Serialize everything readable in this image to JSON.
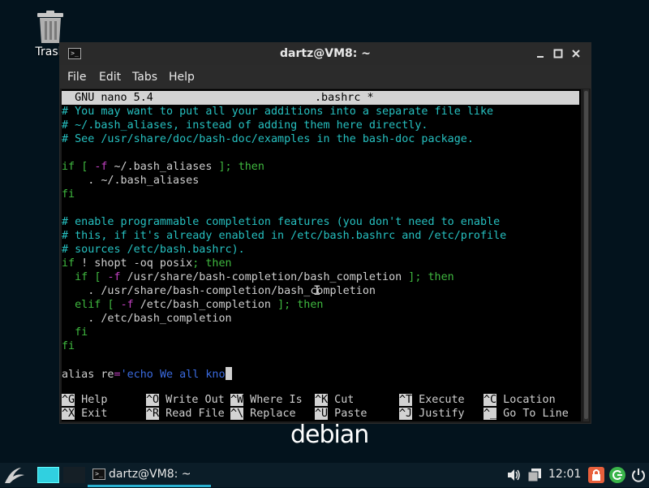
{
  "desktop": {
    "trash_label": "Trash",
    "logo_text": "debian"
  },
  "window": {
    "title": "dartz@VM8: ~",
    "menu": [
      "File",
      "Edit",
      "Tabs",
      "Help"
    ]
  },
  "nano": {
    "header_left": "  GNU nano 5.4",
    "header_file": ".bashrc *",
    "lines": [
      "# You may want to put all your additions into a separate file like",
      "# ~/.bash_aliases, instead of adding them here directly.",
      "# See /usr/share/doc/bash-doc/examples in the bash-doc package.",
      "",
      "if [ -f ~/.bash_aliases ]; then",
      "    . ~/.bash_aliases",
      "fi",
      "",
      "# enable programmable completion features (you don't need to enable",
      "# this, if it's already enabled in /etc/bash.bashrc and /etc/profile",
      "# sources /etc/bash.bashrc).",
      "if ! shopt -oq posix; then",
      "  if [ -f /usr/share/bash-completion/bash_completion ]; then",
      "    . /usr/share/bash-completion/bash_completion",
      "  elif [ -f /etc/bash_completion ]; then",
      "    . /etc/bash_completion",
      "  fi",
      "fi",
      "",
      "alias re='echo We all kno"
    ],
    "shortcuts_row1": [
      {
        "key": "^G",
        "label": "Help"
      },
      {
        "key": "^O",
        "label": "Write Out"
      },
      {
        "key": "^W",
        "label": "Where Is"
      },
      {
        "key": "^K",
        "label": "Cut"
      },
      {
        "key": "^T",
        "label": "Execute"
      },
      {
        "key": "^C",
        "label": "Location"
      }
    ],
    "shortcuts_row2": [
      {
        "key": "^X",
        "label": "Exit"
      },
      {
        "key": "^R",
        "label": "Read File"
      },
      {
        "key": "^\\",
        "label": "Replace"
      },
      {
        "key": "^U",
        "label": "Paste"
      },
      {
        "key": "^J",
        "label": "Justify"
      },
      {
        "key": "^_",
        "label": "Go To Line"
      }
    ]
  },
  "taskbar": {
    "task_label": "dartz@VM8: ~",
    "clock": "12:01"
  },
  "colors": {
    "comment": "#26c0c0",
    "keyword": "#3fb83f",
    "operator": "#c040c0",
    "string": "#3a6adf",
    "accent": "#2ab0d0"
  }
}
